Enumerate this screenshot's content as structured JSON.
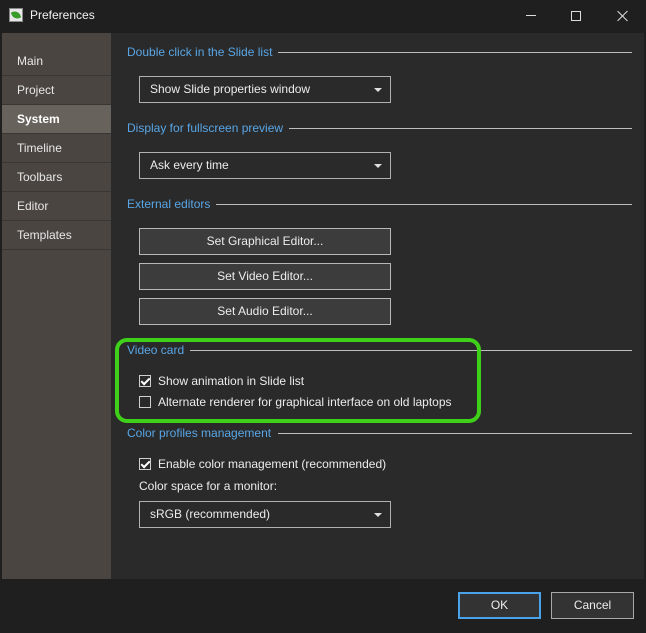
{
  "window": {
    "title": "Preferences"
  },
  "sidebar": {
    "items": [
      {
        "label": "Main"
      },
      {
        "label": "Project"
      },
      {
        "label": "System",
        "active": true
      },
      {
        "label": "Timeline"
      },
      {
        "label": "Toolbars"
      },
      {
        "label": "Editor"
      },
      {
        "label": "Templates"
      }
    ]
  },
  "groups": {
    "double_click": {
      "title": "Double click in the Slide list",
      "selected": "Show Slide properties window"
    },
    "fullscreen_preview": {
      "title": "Display for fullscreen preview",
      "selected": "Ask every time"
    },
    "external_editors": {
      "title": "External editors",
      "graphical_button": "Set Graphical Editor...",
      "video_button": "Set Video Editor...",
      "audio_button": "Set Audio Editor..."
    },
    "video_card": {
      "title": "Video card",
      "show_animation": {
        "label": "Show animation in Slide list",
        "checked": true
      },
      "alternate_renderer": {
        "label": "Alternate renderer for graphical interface on old laptops",
        "checked": false
      }
    },
    "color_profiles": {
      "title": "Color profiles management",
      "enable_color": {
        "label": "Enable color management (recommended)",
        "checked": true
      },
      "color_space_label": "Color space for a monitor:",
      "color_space_selected": "sRGB (recommended)"
    }
  },
  "footer": {
    "ok_label": "OK",
    "cancel_label": "Cancel"
  },
  "colors": {
    "accent_heading": "#58a6e6",
    "highlight": "#3fd11a",
    "sidebar_bg": "#4a4541",
    "sidebar_active": "#68625d"
  }
}
